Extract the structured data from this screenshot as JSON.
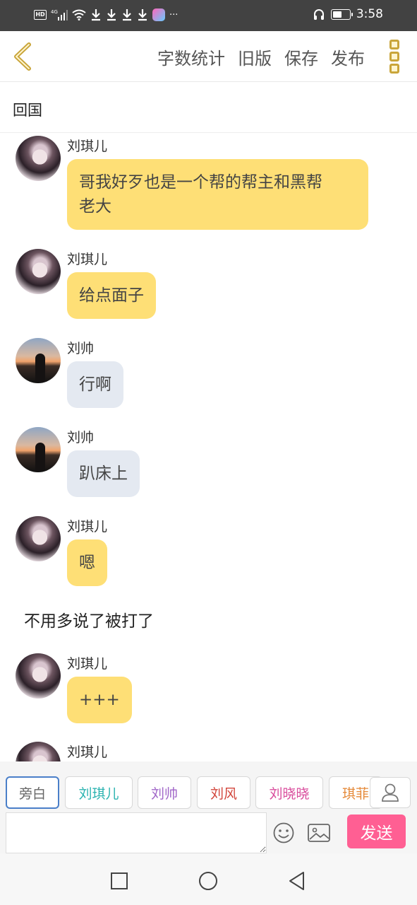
{
  "status_bar": {
    "left_icons": [
      "hd-icon",
      "signal-4g-icon",
      "wifi-icon",
      "download-icon",
      "download-icon",
      "download-icon",
      "download-icon",
      "app-icon",
      "more-icon"
    ],
    "network": "4G",
    "more": "···",
    "time": "3:58",
    "battery_level": 0.45
  },
  "toolbar": {
    "actions": [
      "字数统计",
      "旧版",
      "保存",
      "发布"
    ]
  },
  "chapter": {
    "title": "回国"
  },
  "messages": [
    {
      "type": "chat",
      "sender": "刘琪儿",
      "avatar": "female-avatar",
      "bubble_color": "#fedf76",
      "text_line1": "哥我好歹也是一个帮的帮主和黑帮",
      "text_line2": "老大"
    },
    {
      "type": "chat",
      "sender": "刘琪儿",
      "avatar": "female-avatar",
      "bubble_color": "#fedf76",
      "text": "给点面子"
    },
    {
      "type": "chat",
      "sender": "刘帅",
      "avatar": "male-avatar",
      "bubble_color": "#e4e9f1",
      "text": "行啊"
    },
    {
      "type": "chat",
      "sender": "刘帅",
      "avatar": "male-avatar",
      "bubble_color": "#e4e9f1",
      "text": "趴床上"
    },
    {
      "type": "chat",
      "sender": "刘琪儿",
      "avatar": "female-avatar",
      "bubble_color": "#fedf76",
      "text": "嗯"
    },
    {
      "type": "narration",
      "text": "不用多说了被打了"
    },
    {
      "type": "chat",
      "sender": "刘琪儿",
      "avatar": "female-avatar",
      "bubble_color": "#fedf76",
      "text": "+++"
    },
    {
      "type": "chat",
      "sender": "刘琪儿",
      "avatar": "female-avatar",
      "text": ""
    }
  ],
  "characters": [
    {
      "name": "旁白",
      "color": "#666666",
      "selected": true
    },
    {
      "name": "刘琪儿",
      "color": "#2bb3b0",
      "selected": false
    },
    {
      "name": "刘帅",
      "color": "#a066c8",
      "selected": false
    },
    {
      "name": "刘风",
      "color": "#d2453b",
      "selected": false
    },
    {
      "name": "刘晓晓",
      "color": "#d94c9c",
      "selected": false
    },
    {
      "name": "琪菲",
      "color": "#e58a3a",
      "selected": false
    }
  ],
  "composer": {
    "input_value": "",
    "input_placeholder": "",
    "send_label": "发送"
  },
  "colors": {
    "accent_yellow": "#fedf76",
    "bubble_gray": "#e4e9f1",
    "send_pink": "#ff5f93",
    "back_arrow": "#c9a53a"
  }
}
